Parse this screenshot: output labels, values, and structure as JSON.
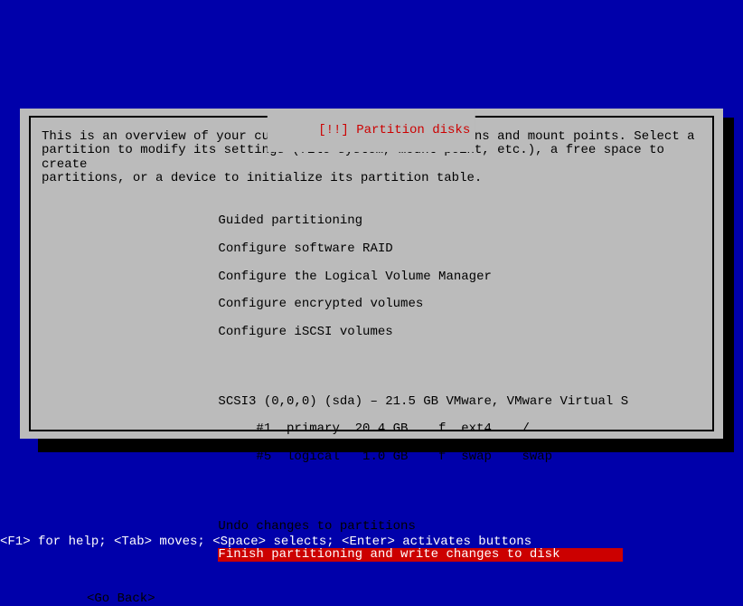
{
  "dialog": {
    "title": "[!!] Partition disks",
    "description": "This is an overview of your currently configured partitions and mount points. Select a\npartition to modify its settings (file system, mount point, etc.), a free space to create\npartitions, or a device to initialize its partition table.",
    "menu": {
      "guided": "Guided partitioning",
      "raid": "Configure software RAID",
      "lvm": "Configure the Logical Volume Manager",
      "encrypted": "Configure encrypted volumes",
      "iscsi": "Configure iSCSI volumes",
      "disk_header": "SCSI3 (0,0,0) (sda) – 21.5 GB VMware, VMware Virtual S",
      "part1": "     #1  primary  20.4 GB    f  ext4    /",
      "part5": "     #5  logical   1.0 GB    f  swap    swap",
      "undo": "Undo changes to partitions",
      "finish": "Finish partitioning and write changes to disk"
    },
    "go_back": "<Go Back>"
  },
  "help_bar": "<F1> for help; <Tab> moves; <Space> selects; <Enter> activates buttons"
}
